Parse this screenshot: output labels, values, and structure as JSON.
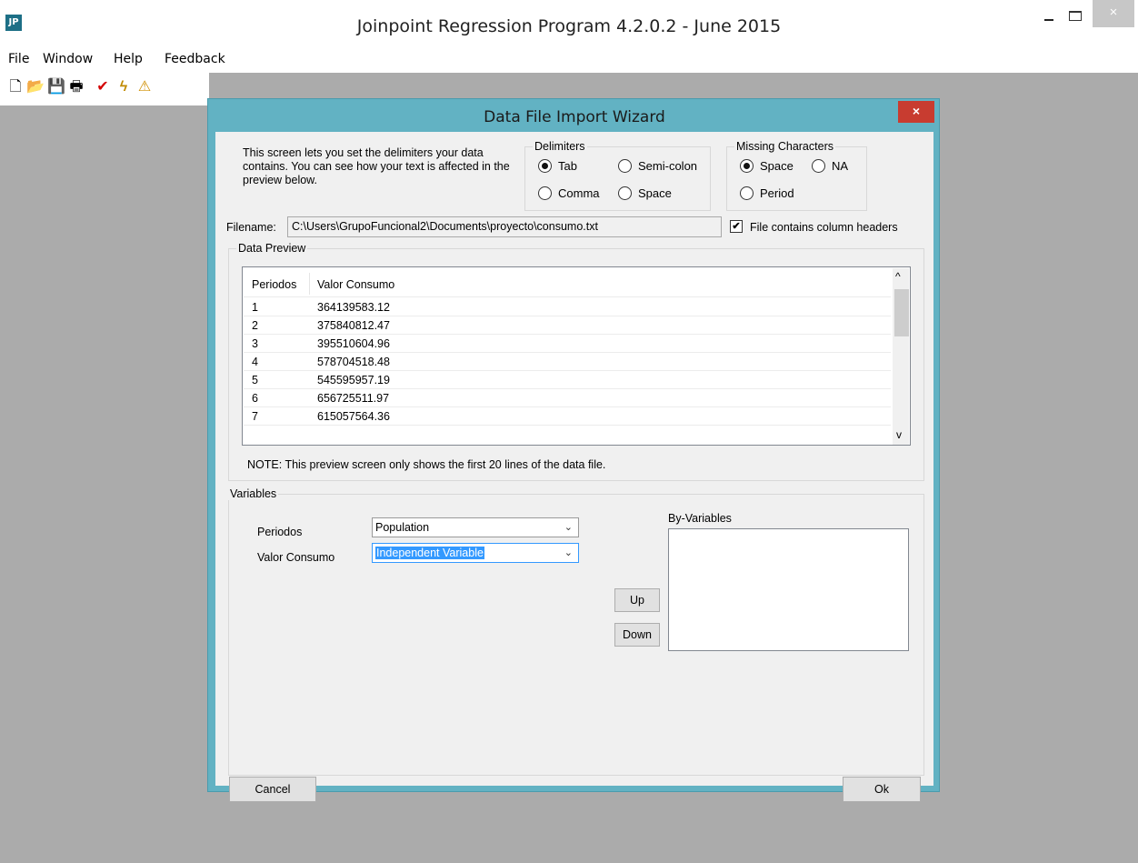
{
  "app": {
    "title": "Joinpoint Regression Program 4.2.0.2 - June 2015",
    "icon_text": "JP",
    "close_glyph": "×"
  },
  "menu": [
    "File",
    "Window",
    "Help",
    "Feedback"
  ],
  "toolbar": {
    "icons": [
      "new-file-icon",
      "open-folder-icon",
      "save-icon",
      "print-icon",
      "check-icon",
      "lightning-icon",
      "warning-icon"
    ],
    "glyphs": [
      "🗋",
      "📂",
      "💾",
      "🖶",
      "✔",
      "ϟ",
      "⚠"
    ],
    "colors": {
      "check": "#d40000",
      "lightning": "#c08a00",
      "warning": "#d08f00"
    }
  },
  "dialog": {
    "title": "Data File Import Wizard",
    "close_glyph": "×",
    "intro": "This screen lets you set the delimiters your data contains. You can see how your text is affected in the preview below.",
    "delimiters": {
      "label": "Delimiters",
      "options": [
        {
          "label": "Tab",
          "selected": true
        },
        {
          "label": "Semi-colon",
          "selected": false
        },
        {
          "label": "Comma",
          "selected": false
        },
        {
          "label": "Space",
          "selected": false
        }
      ]
    },
    "missing": {
      "label": "Missing Characters",
      "options": [
        {
          "label": "Space",
          "selected": true
        },
        {
          "label": "NA",
          "selected": false
        },
        {
          "label": "Period",
          "selected": false
        }
      ]
    },
    "filename_label": "Filename:",
    "filename_value": "C:\\Users\\GrupoFuncional2\\Documents\\proyecto\\consumo.txt",
    "column_headers_checkbox": {
      "label": "File contains column headers",
      "checked": true,
      "glyph": "✔"
    },
    "data_preview": {
      "label": "Data Preview",
      "columns": [
        "Periodos",
        "Valor Consumo"
      ],
      "rows": [
        [
          "1",
          "364139583.12"
        ],
        [
          "2",
          "375840812.47"
        ],
        [
          "3",
          "395510604.96"
        ],
        [
          "4",
          "578704518.48"
        ],
        [
          "5",
          "545595957.19"
        ],
        [
          "6",
          "656725511.97"
        ],
        [
          "7",
          "615057564.36"
        ]
      ],
      "scroll_up_glyph": "^",
      "scroll_down_glyph": "v",
      "note": "NOTE: This preview screen only shows the first 20 lines of the data file."
    },
    "variables": {
      "label": "Variables",
      "items": [
        {
          "name": "Periodos",
          "value": "Population"
        },
        {
          "name": "Valor Consumo",
          "value": "Independent Variable"
        }
      ],
      "dropdown_glyph": "⌄",
      "by_variables_label": "By-Variables",
      "up_label": "Up",
      "down_label": "Down"
    },
    "cancel_label": "Cancel",
    "ok_label": "Ok",
    "accent": "#3399ff"
  }
}
